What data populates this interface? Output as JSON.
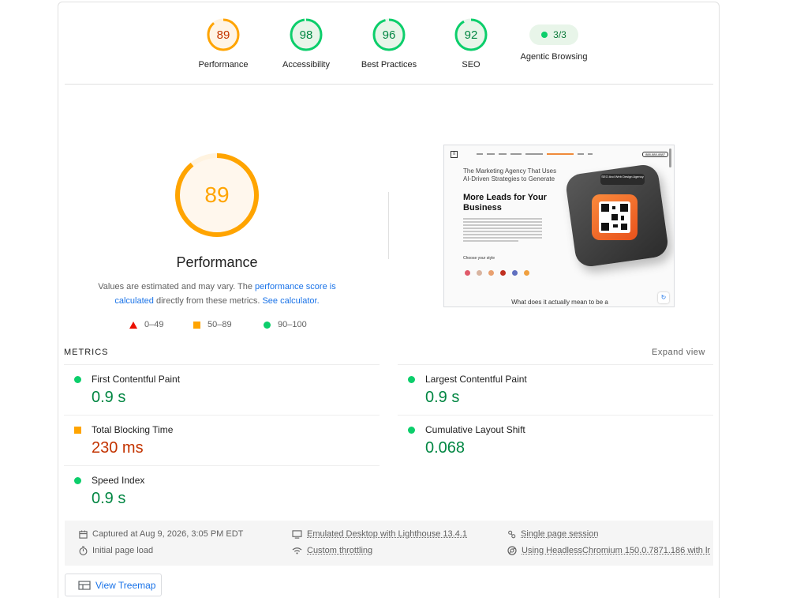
{
  "gauges": [
    {
      "score": "89",
      "label": "Performance",
      "color": "#ffa400",
      "text_color": "#c33300",
      "fraction": 0.89
    },
    {
      "score": "98",
      "label": "Accessibility",
      "color": "#0cce6b",
      "text_color": "#018642",
      "fraction": 0.98
    },
    {
      "score": "96",
      "label": "Best Practices",
      "color": "#0cce6b",
      "text_color": "#018642",
      "fraction": 0.96
    },
    {
      "score": "92",
      "label": "SEO",
      "color": "#0cce6b",
      "text_color": "#018642",
      "fraction": 0.92
    }
  ],
  "agentic": {
    "value": "3/3",
    "label": "Agentic Browsing"
  },
  "performance": {
    "score": "89",
    "fraction": 0.89,
    "title": "Performance",
    "desc_part1": "Values are estimated and may vary. The ",
    "desc_link1": "performance score is calculated",
    "desc_part2": " directly from these metrics. ",
    "desc_link2": "See calculator."
  },
  "legend": {
    "fail": "0–49",
    "average": "50–89",
    "pass": "90–100"
  },
  "screenshot": {
    "nav_cta": "888-888-8887",
    "subtitle": "The Marketing Agency That Uses AI-Driven Strategies to Generate",
    "heading": "More Leads for Your Business",
    "style_label": "Choose your style",
    "badge": "SEO And Web Design Agency",
    "bottom_text": "What does it actually mean to be a"
  },
  "metrics": {
    "title": "METRICS",
    "expand": "Expand view",
    "items": [
      {
        "name": "First Contentful Paint",
        "value": "0.9 s",
        "rating": "good"
      },
      {
        "name": "Largest Contentful Paint",
        "value": "0.9 s",
        "rating": "good"
      },
      {
        "name": "Total Blocking Time",
        "value": "230 ms",
        "rating": "avg"
      },
      {
        "name": "Cumulative Layout Shift",
        "value": "0.068",
        "rating": "good"
      },
      {
        "name": "Speed Index",
        "value": "0.9 s",
        "rating": "good"
      }
    ]
  },
  "info": {
    "captured": "Captured at Aug 9, 2026, 3:05 PM EDT",
    "initial_load": "Initial page load",
    "emulated": "Emulated Desktop with Lighthouse 13.4.1",
    "throttling": "Custom throttling",
    "session": "Single page session",
    "browser": "Using HeadlessChromium 150.0.7871.186 with lr"
  },
  "treemap": {
    "label": "View Treemap"
  }
}
